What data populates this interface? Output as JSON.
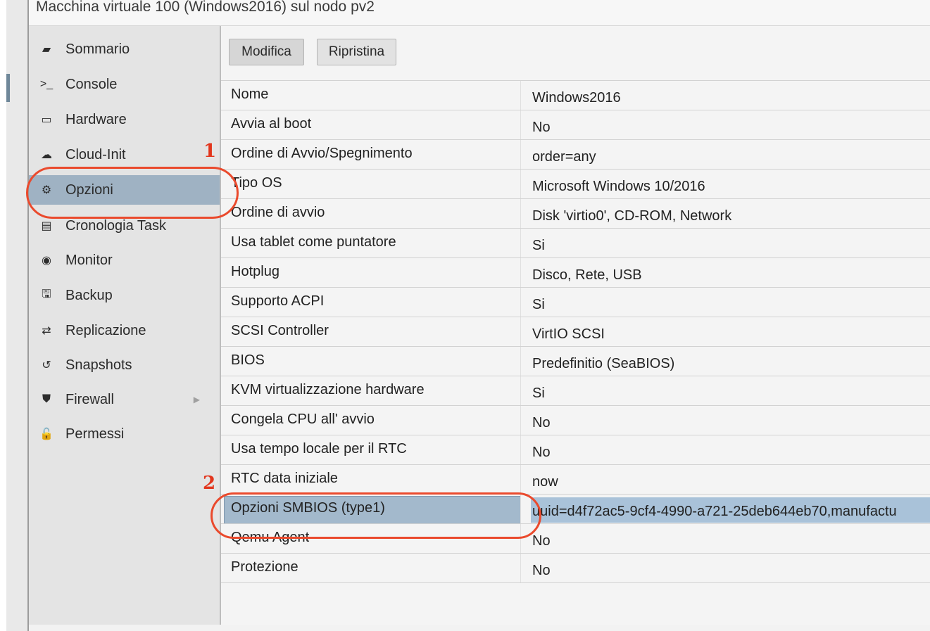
{
  "window": {
    "title": "Macchina virtuale 100 (Windows2016) sul nodo pv2"
  },
  "sidebar": {
    "items": [
      {
        "label": "Sommario",
        "icon": "book-icon",
        "glyph": "▰"
      },
      {
        "label": "Console",
        "icon": "terminal-icon",
        "glyph": ">_"
      },
      {
        "label": "Hardware",
        "icon": "monitor-icon",
        "glyph": "▭"
      },
      {
        "label": "Cloud-Init",
        "icon": "cloud-icon",
        "glyph": "☁"
      },
      {
        "label": "Opzioni",
        "icon": "gear-icon",
        "glyph": "⚙"
      },
      {
        "label": "Cronologia Task",
        "icon": "list-icon",
        "glyph": "▤"
      },
      {
        "label": "Monitor",
        "icon": "eye-icon",
        "glyph": "◉"
      },
      {
        "label": "Backup",
        "icon": "floppy-icon",
        "glyph": "🖫"
      },
      {
        "label": "Replicazione",
        "icon": "retweet-icon",
        "glyph": "⇄"
      },
      {
        "label": "Snapshots",
        "icon": "history-icon",
        "glyph": "↺"
      },
      {
        "label": "Firewall",
        "icon": "shield-icon",
        "glyph": "⛊"
      },
      {
        "label": "Permessi",
        "icon": "unlock-icon",
        "glyph": "🔓"
      }
    ],
    "selected": "Opzioni"
  },
  "toolbar": {
    "edit_label": "Modifica",
    "revert_label": "Ripristina"
  },
  "options": [
    {
      "key": "Nome",
      "value": "Windows2016"
    },
    {
      "key": "Avvia al boot",
      "value": "No"
    },
    {
      "key": "Ordine di Avvio/Spegnimento",
      "value": "order=any"
    },
    {
      "key": "Tipo OS",
      "value": "Microsoft Windows 10/2016"
    },
    {
      "key": "Ordine di avvio",
      "value": "Disk 'virtio0', CD-ROM, Network"
    },
    {
      "key": "Usa tablet come puntatore",
      "value": "Si"
    },
    {
      "key": "Hotplug",
      "value": "Disco, Rete, USB"
    },
    {
      "key": "Supporto ACPI",
      "value": "Si"
    },
    {
      "key": "SCSI Controller",
      "value": "VirtIO SCSI"
    },
    {
      "key": "BIOS",
      "value": "Predefinitio (SeaBIOS)"
    },
    {
      "key": "KVM virtualizzazione hardware",
      "value": "Si"
    },
    {
      "key": "Congela CPU all' avvio",
      "value": "No"
    },
    {
      "key": "Usa tempo locale per il RTC",
      "value": "No"
    },
    {
      "key": "RTC data iniziale",
      "value": "now"
    },
    {
      "key": "Opzioni SMBIOS (type1)",
      "value": "uuid=d4f72ac5-9cf4-4990-a721-25deb644eb70,manufactu"
    },
    {
      "key": "Qemu Agent",
      "value": "No"
    },
    {
      "key": "Protezione",
      "value": "No"
    }
  ],
  "selected_option": "Opzioni SMBIOS (type1)",
  "annotations": {
    "marker_1": "1",
    "marker_2": "2",
    "color": "#e2361d"
  },
  "colors": {
    "selection": "#9fb2c3",
    "accent_red": "#ea4a2d"
  }
}
